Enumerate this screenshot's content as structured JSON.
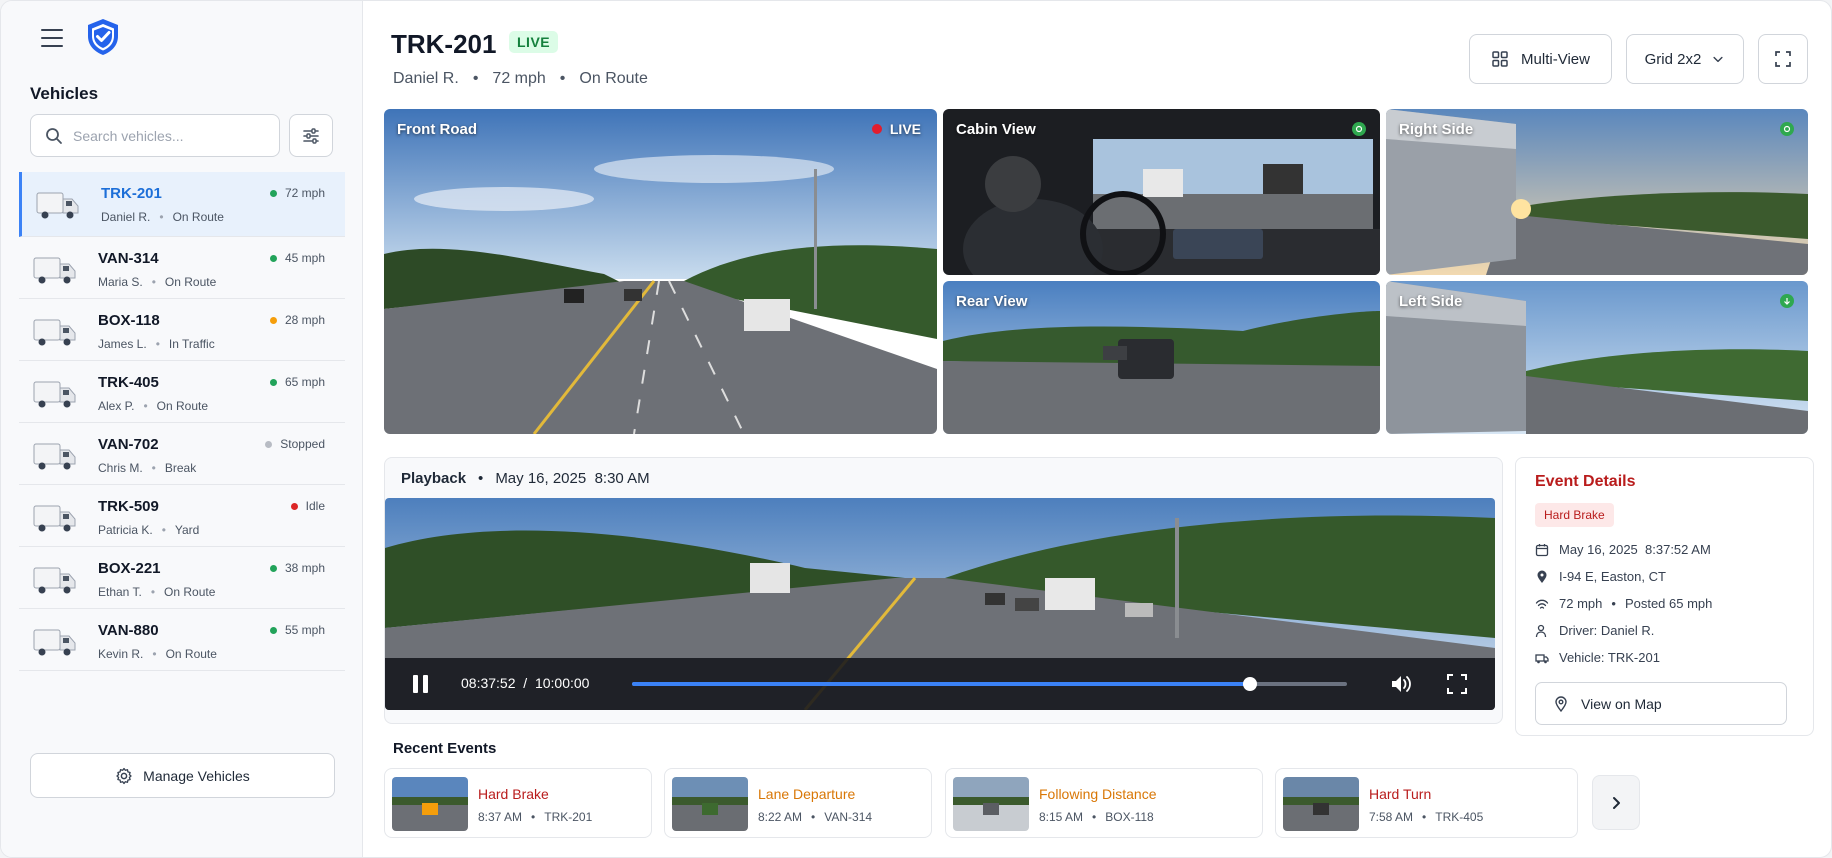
{
  "sidebar": {
    "title": "Vehicles",
    "search_placeholder": "Search vehicles...",
    "manage_label": "Manage Vehicles",
    "vehicles": [
      {
        "id": "TRK-201",
        "driver": "Daniel R.",
        "state": "On Route",
        "status": "72 mph",
        "status_color": "#22a35a",
        "active": true
      },
      {
        "id": "VAN-314",
        "driver": "Maria S.",
        "state": "On Route",
        "status": "45 mph",
        "status_color": "#22a35a"
      },
      {
        "id": "BOX-118",
        "driver": "James L.",
        "state": "In Traffic",
        "status": "28 mph",
        "status_color": "#f59e0b"
      },
      {
        "id": "TRK-405",
        "driver": "Alex P.",
        "state": "On Route",
        "status": "65 mph",
        "status_color": "#22a35a"
      },
      {
        "id": "VAN-702",
        "driver": "Chris M.",
        "state": "Break",
        "status": "Stopped",
        "status_color": "#b8bcc4"
      },
      {
        "id": "TRK-509",
        "driver": "Patricia K.",
        "state": "Yard",
        "status": "Idle",
        "status_color": "#dc2626"
      },
      {
        "id": "BOX-221",
        "driver": "Ethan T.",
        "state": "On Route",
        "status": "38 mph",
        "status_color": "#22a35a"
      },
      {
        "id": "VAN-880",
        "driver": "Kevin R.",
        "state": "On Route",
        "status": "55 mph",
        "status_color": "#22a35a"
      }
    ]
  },
  "header": {
    "vehicle_id": "TRK-201",
    "live_label": "LIVE",
    "driver": "Daniel R.",
    "speed": "72 mph",
    "state": "On Route",
    "multiview_label": "Multi-View",
    "grid_label": "Grid 2x2"
  },
  "cameras": {
    "front": {
      "label": "Front Road",
      "live": "LIVE"
    },
    "cabin": {
      "label": "Cabin View"
    },
    "right": {
      "label": "Right Side"
    },
    "rear": {
      "label": "Rear View"
    },
    "left": {
      "label": "Left Side"
    }
  },
  "playback": {
    "title": "Playback",
    "date": "May 16, 2025",
    "time": "8:30 AM",
    "current": "08:37:52",
    "separator": "/",
    "duration": "10:00:00",
    "progress": 0.865
  },
  "event_details": {
    "title": "Event Details",
    "badge": "Hard Brake",
    "date": "May 16, 2025",
    "time": "8:37:52 AM",
    "location": "I-94 E, Easton, CT",
    "speed": "72 mph",
    "posted": "Posted 65 mph",
    "driver": "Driver: Daniel R.",
    "vehicle": "Vehicle: TRK-201",
    "map_label": "View on Map"
  },
  "recent_events": {
    "title": "Recent Events",
    "items": [
      {
        "title": "Hard Brake",
        "time": "8:37 AM",
        "vehicle": "TRK-201",
        "color": "#b91c1c"
      },
      {
        "title": "Lane Departure",
        "time": "8:22 AM",
        "vehicle": "VAN-314",
        "color": "#d97706"
      },
      {
        "title": "Following Distance",
        "time": "8:15 AM",
        "vehicle": "BOX-118",
        "color": "#d97706"
      },
      {
        "title": "Hard Turn",
        "time": "7:58 AM",
        "vehicle": "TRK-405",
        "color": "#b91c1c"
      }
    ]
  },
  "colors": {
    "accent": "#3b82f6",
    "live_green": "#15803d",
    "alert_red": "#b91c1c",
    "warn_orange": "#d97706"
  }
}
